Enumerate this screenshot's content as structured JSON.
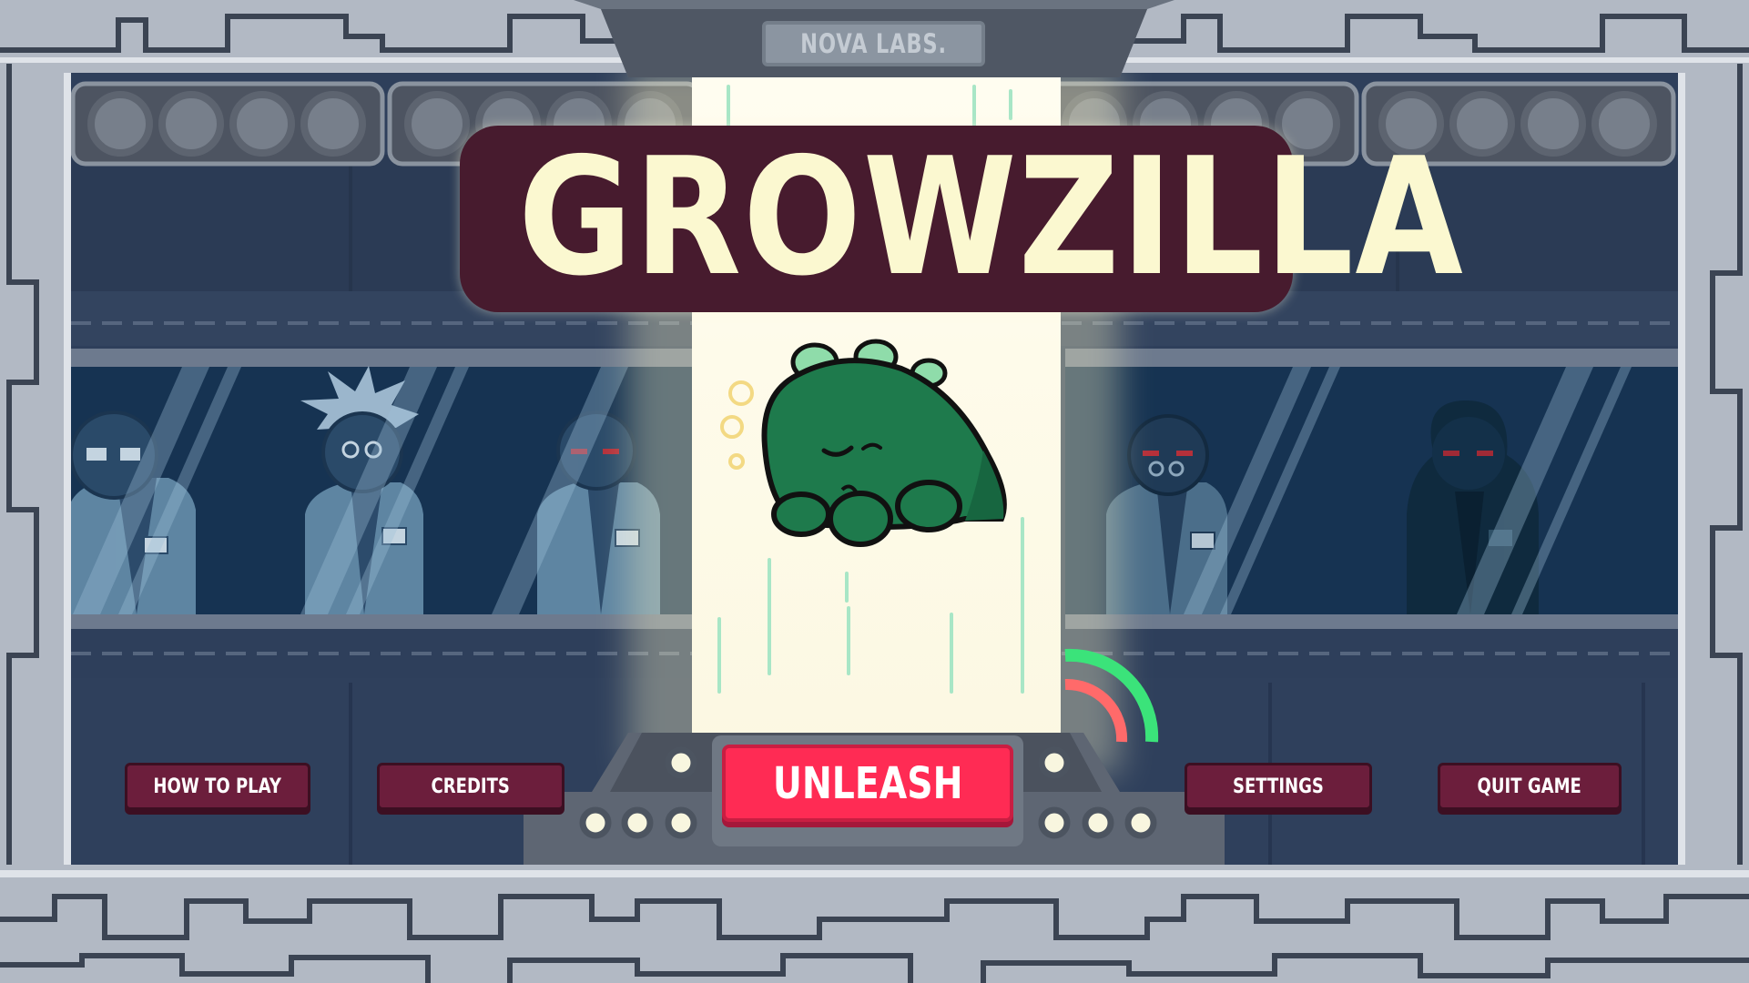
{
  "header": {
    "studio_badge": "NOVA LABS."
  },
  "title": {
    "text": "GROWZILLA"
  },
  "menu": {
    "how_to_play": "HOW TO PLAY",
    "credits": "CREDITS",
    "unleash": "UNLEASH",
    "settings": "SETTINGS",
    "quit_game": "QUIT GAME"
  },
  "colors": {
    "wall": "#2e3f5b",
    "frame": "#b2b9c4",
    "beam": "#fdfbe9",
    "creature": "#1e7a4c",
    "title_bg": "#471b2e",
    "title_text": "#fbf8d0",
    "menu_button": "#6c1e3c",
    "unleash_button": "#ff2b54",
    "dial_green": "#3be37a",
    "dial_red": "#ff6a6a"
  },
  "icons": [
    "scientist-glasses-icon",
    "scientist-spiky-hair-icon",
    "scientist-red-eyes-icon",
    "scientist-round-glasses-icon",
    "hooded-figure-icon",
    "creature-icon",
    "bubble-icon",
    "dial-gauge-icon"
  ]
}
